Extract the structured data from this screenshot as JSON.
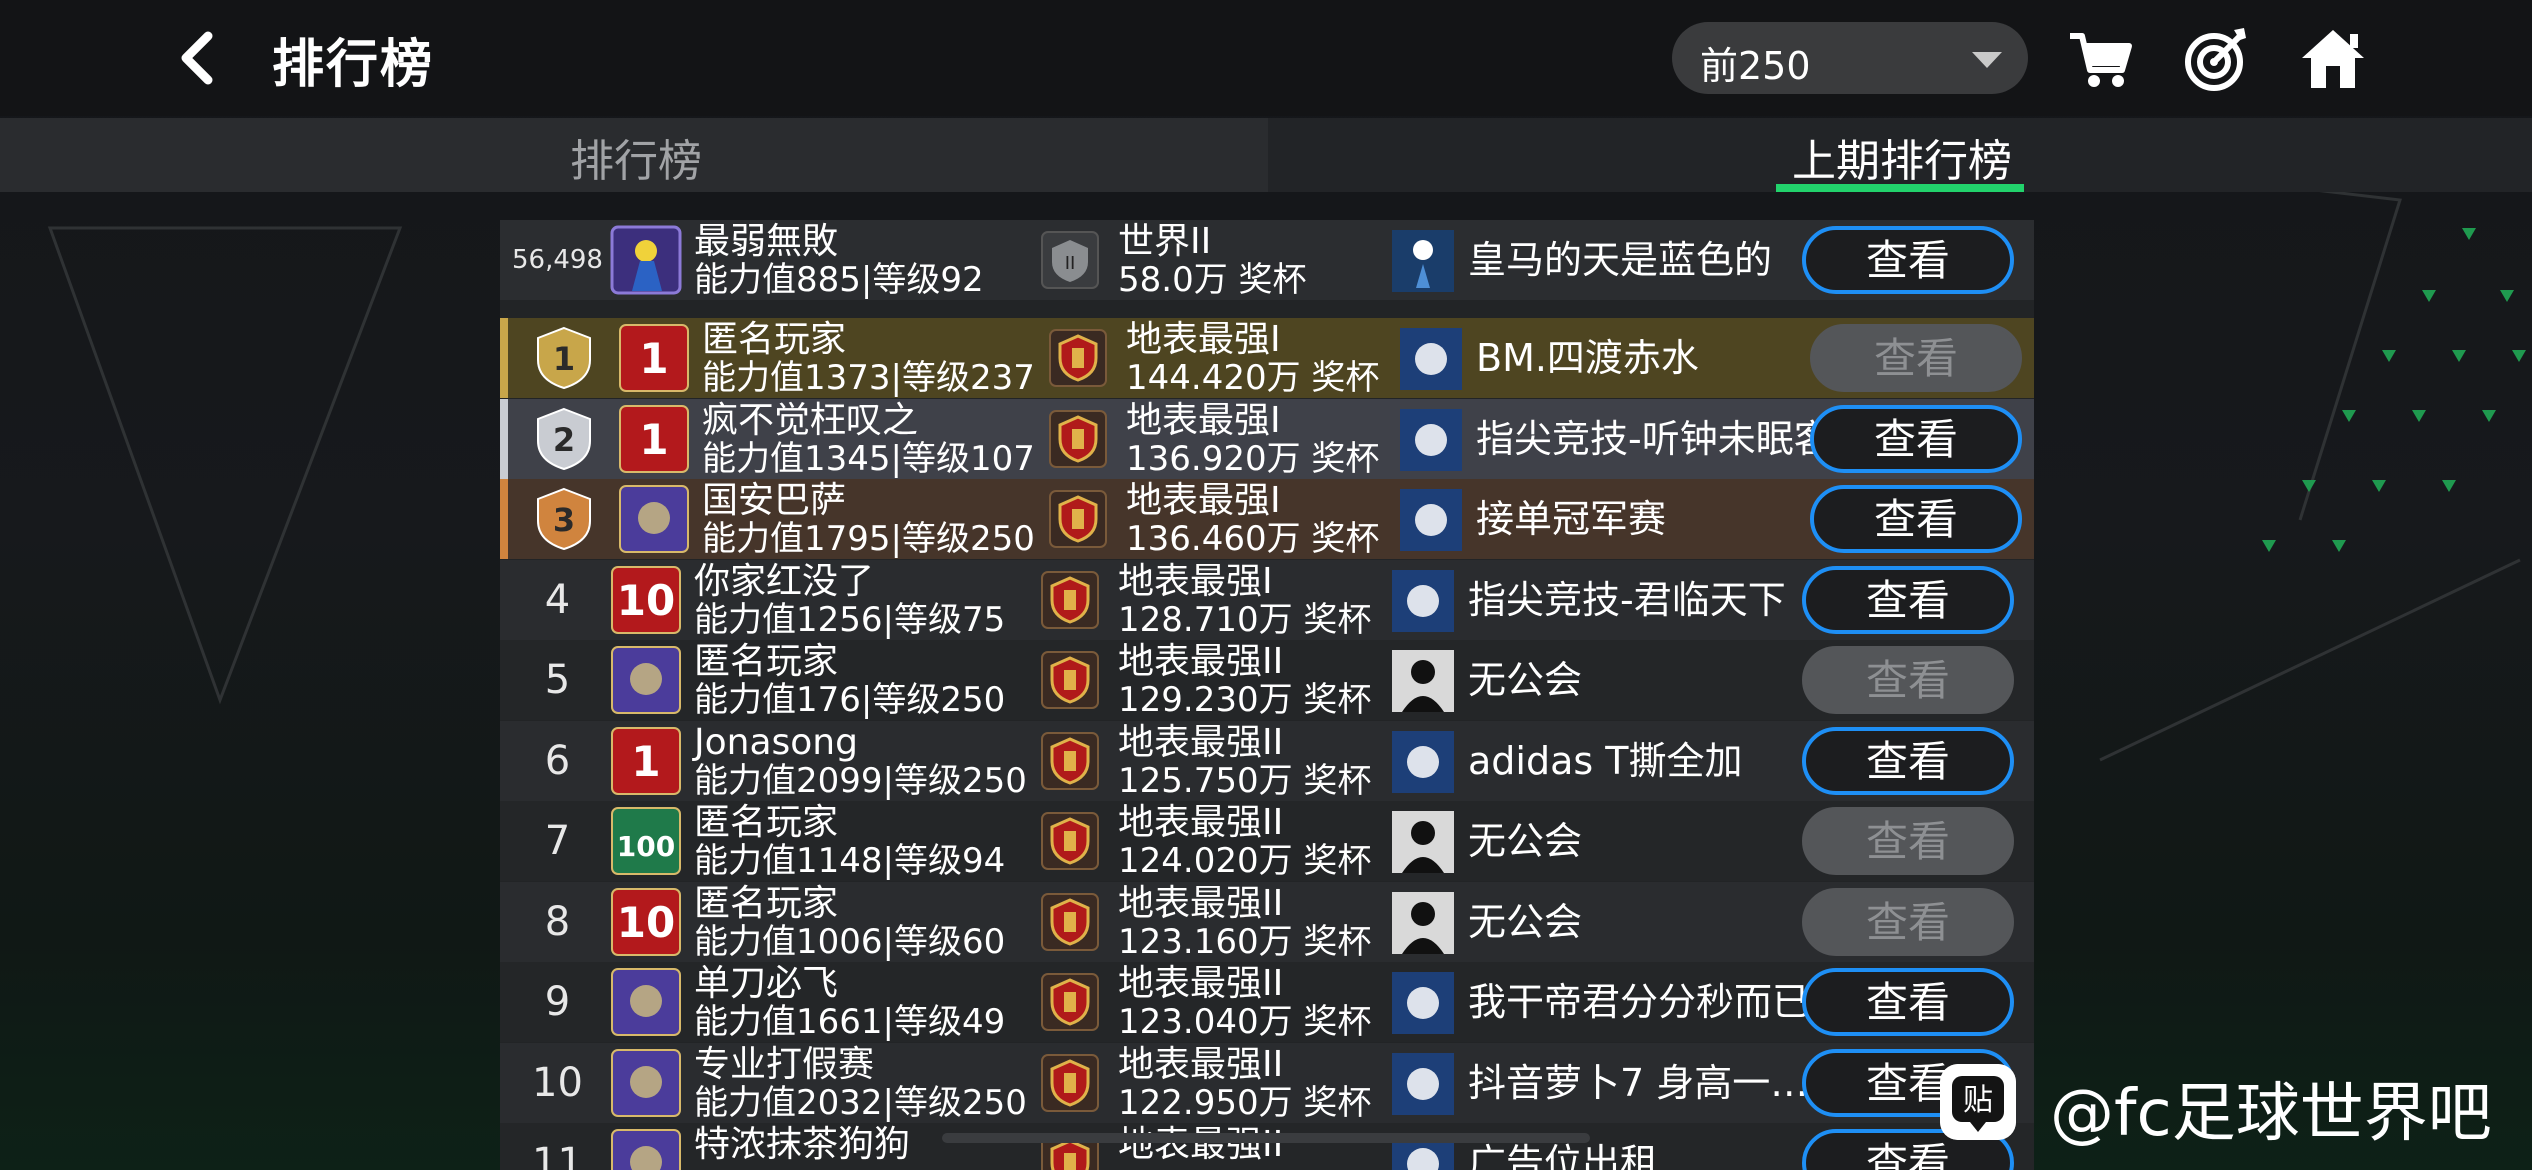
{
  "header": {
    "title": "排行榜",
    "range_value": "前250"
  },
  "tabs": {
    "ranking": "排行榜",
    "last_period": "上期排行榜",
    "active": "last_period"
  },
  "my_row": {
    "rank": "56,498",
    "name": "最弱無敗",
    "stats": "能力值885|等级92",
    "tier": "世界II",
    "prize": "58.0万 奖杯",
    "club": "皇马的天是蓝色的",
    "view_label": "查看",
    "view_enabled": true
  },
  "rows": [
    {
      "rank": "1",
      "medal": "1",
      "name": "匿名玩家",
      "stats": "能力值1373|等级237",
      "tier": "地表最强I",
      "prize": "144.420万 奖杯",
      "club": "BM.四渡赤水",
      "view_label": "查看",
      "view_enabled": false,
      "highlight": "#4e4521",
      "card": "1"
    },
    {
      "rank": "2",
      "medal": "2",
      "name": "疯不觉枉叹之",
      "stats": "能力值1345|等级107",
      "tier": "地表最强I",
      "prize": "136.920万 奖杯",
      "club": "指尖竞技-听钟未眠客",
      "view_label": "查看",
      "view_enabled": true,
      "highlight": "#3f4149",
      "card": "1"
    },
    {
      "rank": "3",
      "medal": "3",
      "name": "国安巴萨",
      "stats": "能力值1795|等级250",
      "tier": "地表最强I",
      "prize": "136.460万 奖杯",
      "club": "接单冠军赛",
      "view_label": "查看",
      "view_enabled": true,
      "highlight": "#46352a",
      "card": ""
    },
    {
      "rank": "4",
      "name": "你家红没了",
      "stats": "能力值1256|等级75",
      "tier": "地表最强I",
      "prize": "128.710万 奖杯",
      "club": "指尖竞技-君临天下",
      "view_label": "查看",
      "view_enabled": true,
      "card": "10"
    },
    {
      "rank": "5",
      "name": "匿名玩家",
      "stats": "能力值176|等级250",
      "tier": "地表最强II",
      "prize": "129.230万 奖杯",
      "club": "无公会",
      "view_label": "查看",
      "view_enabled": false,
      "card": ""
    },
    {
      "rank": "6",
      "name": "Jonasong",
      "stats": "能力值2099|等级250",
      "tier": "地表最强II",
      "prize": "125.750万 奖杯",
      "club": "adidas T撕全加",
      "view_label": "查看",
      "view_enabled": true,
      "card": "1"
    },
    {
      "rank": "7",
      "name": "匿名玩家",
      "stats": "能力值1148|等级94",
      "tier": "地表最强II",
      "prize": "124.020万 奖杯",
      "club": "无公会",
      "view_label": "查看",
      "view_enabled": false,
      "card": "100"
    },
    {
      "rank": "8",
      "name": "匿名玩家",
      "stats": "能力值1006|等级60",
      "tier": "地表最强II",
      "prize": "123.160万 奖杯",
      "club": "无公会",
      "view_label": "查看",
      "view_enabled": false,
      "card": "10"
    },
    {
      "rank": "9",
      "name": "单刀必飞",
      "stats": "能力值1661|等级49",
      "tier": "地表最强II",
      "prize": "123.040万 奖杯",
      "club": "我干帝君分分秒而已",
      "view_label": "查看",
      "view_enabled": true,
      "card": ""
    },
    {
      "rank": "10",
      "name": "专业打假赛",
      "stats": "能力值2032|等级250",
      "tier": "地表最强II",
      "prize": "122.950万 奖杯",
      "club": "抖音萝卜7 身高一…",
      "view_label": "查看",
      "view_enabled": true,
      "card": ""
    },
    {
      "rank": "11",
      "name": "特浓抹茶狗狗",
      "stats": "",
      "tier": "地表最强II",
      "prize": "",
      "club": "广告位出租",
      "view_label": "查看",
      "view_enabled": true,
      "card": ""
    }
  ],
  "watermark": {
    "icon_text": "贴",
    "text": "@fc足球世界吧"
  },
  "colors": {
    "accent_blue": "#1e8ff5",
    "tab_underline": "#22d36c",
    "gold": "#c8a64a",
    "medal_silver": "#c9ccd2",
    "medal_bronze": "#d0843e"
  }
}
